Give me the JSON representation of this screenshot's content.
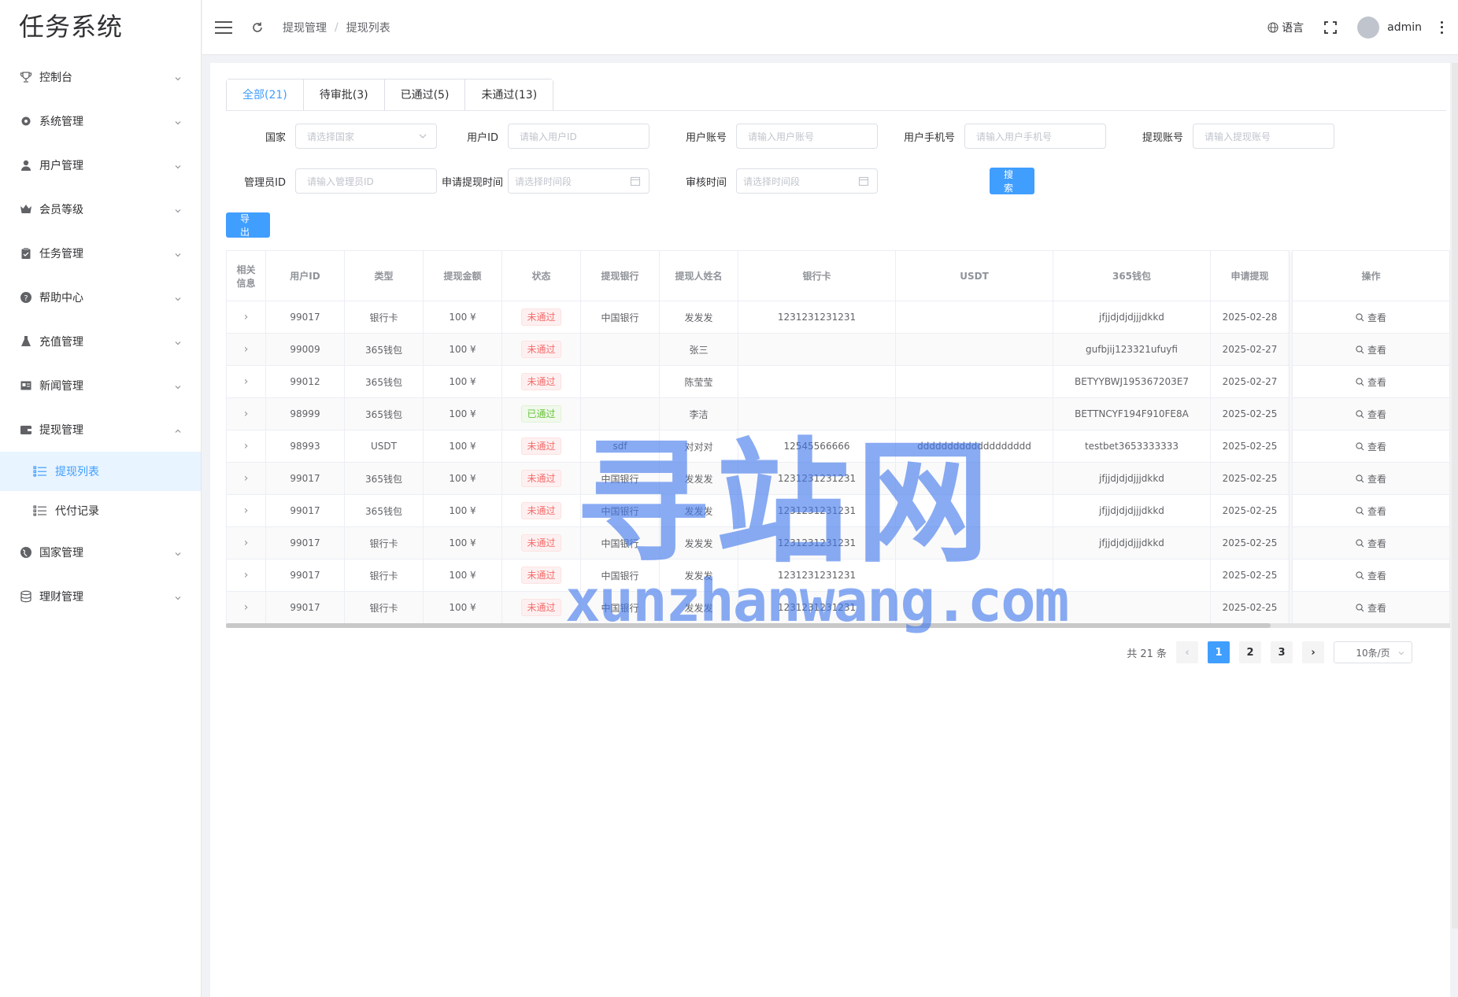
{
  "app": {
    "title": "任务系统"
  },
  "sidebar": {
    "items": [
      {
        "label": "控制台",
        "icon": "trophy-icon"
      },
      {
        "label": "系统管理",
        "icon": "gear-icon"
      },
      {
        "label": "用户管理",
        "icon": "user-icon"
      },
      {
        "label": "会员等级",
        "icon": "crown-icon"
      },
      {
        "label": "任务管理",
        "icon": "clipboard-icon"
      },
      {
        "label": "帮助中心",
        "icon": "question-icon"
      },
      {
        "label": "充值管理",
        "icon": "flask-icon"
      },
      {
        "label": "新闻管理",
        "icon": "news-icon"
      },
      {
        "label": "提现管理",
        "icon": "wallet-icon",
        "expanded": true
      }
    ],
    "submenu": [
      {
        "label": "提现列表",
        "active": true
      },
      {
        "label": "代付记录",
        "active": false
      }
    ],
    "items_after": [
      {
        "label": "国家管理",
        "icon": "globe-icon"
      },
      {
        "label": "理财管理",
        "icon": "database-icon"
      }
    ]
  },
  "header": {
    "breadcrumb": [
      "提现管理",
      "提现列表"
    ],
    "breadcrumb_sep": "/",
    "language_label": "语言",
    "username": "admin"
  },
  "tabs": [
    {
      "label": "全部(21)",
      "active": true
    },
    {
      "label": "待审批(3)",
      "active": false
    },
    {
      "label": "已通过(5)",
      "active": false
    },
    {
      "label": "未通过(13)",
      "active": false
    }
  ],
  "filters": {
    "country": {
      "label": "国家",
      "placeholder": "请选择国家"
    },
    "user_id": {
      "label": "用户ID",
      "placeholder": "请输入用户ID"
    },
    "user_account": {
      "label": "用户账号",
      "placeholder": "请输入用户账号"
    },
    "user_phone": {
      "label": "用户手机号",
      "placeholder": "请输入用户手机号"
    },
    "withdraw_account": {
      "label": "提现账号",
      "placeholder": "请输入提现账号"
    },
    "admin_id": {
      "label": "管理员ID",
      "placeholder": "请输入管理员ID"
    },
    "apply_time": {
      "label": "申请提现时间",
      "placeholder": "请选择时间段"
    },
    "review_time": {
      "label": "审核时间",
      "placeholder": "请选择时间段"
    },
    "search_label": "搜索"
  },
  "export_label": "导出",
  "table": {
    "columns": {
      "related_1": "相关",
      "related_2": "信息",
      "user_id": "用户ID",
      "type": "类型",
      "amount": "提现金额",
      "status": "状态",
      "bank": "提现银行",
      "name": "提现人姓名",
      "card": "银行卡",
      "usdt": "USDT",
      "wallet": "365钱包",
      "apply": "申请提现",
      "action": "操作"
    },
    "view_label": "查看",
    "rows": [
      {
        "user_id": "99017",
        "type": "银行卡",
        "amount": "100 ¥",
        "status": "未通过",
        "status_kind": "fail",
        "bank": "中国银行",
        "name": "发发发",
        "card": "1231231231231",
        "usdt": "",
        "wallet": "jfjjdjdjdjjjdkkd",
        "apply": "2025-02-28"
      },
      {
        "user_id": "99009",
        "type": "365钱包",
        "amount": "100 ¥",
        "status": "未通过",
        "status_kind": "fail",
        "bank": "",
        "name": "张三",
        "card": "",
        "usdt": "",
        "wallet": "gufbjij123321ufuyfi",
        "apply": "2025-02-27"
      },
      {
        "user_id": "99012",
        "type": "365钱包",
        "amount": "100 ¥",
        "status": "未通过",
        "status_kind": "fail",
        "bank": "",
        "name": "陈莹莹",
        "card": "",
        "usdt": "",
        "wallet": "BETYYBWJ195367203E7",
        "apply": "2025-02-27"
      },
      {
        "user_id": "98999",
        "type": "365钱包",
        "amount": "100 ¥",
        "status": "已通过",
        "status_kind": "pass",
        "bank": "",
        "name": "李洁",
        "card": "",
        "usdt": "",
        "wallet": "BETTNCYF194F910FE8A",
        "apply": "2025-02-25"
      },
      {
        "user_id": "98993",
        "type": "USDT",
        "amount": "100 ¥",
        "status": "未通过",
        "status_kind": "fail",
        "bank": "sdf",
        "name": "对对对",
        "card": "12545566666",
        "usdt": "ddddddddddddddddddd",
        "wallet": "testbet3653333333",
        "apply": "2025-02-25"
      },
      {
        "user_id": "99017",
        "type": "365钱包",
        "amount": "100 ¥",
        "status": "未通过",
        "status_kind": "fail",
        "bank": "中国银行",
        "name": "发发发",
        "card": "1231231231231",
        "usdt": "",
        "wallet": "jfjjdjdjdjjjdkkd",
        "apply": "2025-02-25"
      },
      {
        "user_id": "99017",
        "type": "365钱包",
        "amount": "100 ¥",
        "status": "未通过",
        "status_kind": "fail",
        "bank": "中国银行",
        "name": "发发发",
        "card": "1231231231231",
        "usdt": "",
        "wallet": "jfjjdjdjdjjjdkkd",
        "apply": "2025-02-25"
      },
      {
        "user_id": "99017",
        "type": "银行卡",
        "amount": "100 ¥",
        "status": "未通过",
        "status_kind": "fail",
        "bank": "中国银行",
        "name": "发发发",
        "card": "1231231231231",
        "usdt": "",
        "wallet": "jfjjdjdjdjjjdkkd",
        "apply": "2025-02-25"
      },
      {
        "user_id": "99017",
        "type": "银行卡",
        "amount": "100 ¥",
        "status": "未通过",
        "status_kind": "fail",
        "bank": "中国银行",
        "name": "发发发",
        "card": "1231231231231",
        "usdt": "",
        "wallet": "",
        "apply": "2025-02-25"
      },
      {
        "user_id": "99017",
        "type": "银行卡",
        "amount": "100 ¥",
        "status": "未通过",
        "status_kind": "fail",
        "bank": "中国银行",
        "name": "发发发",
        "card": "1231231231231",
        "usdt": "",
        "wallet": "",
        "apply": "2025-02-25"
      }
    ]
  },
  "pagination": {
    "total_label": "共 21 条",
    "pages": [
      "1",
      "2",
      "3"
    ],
    "current_page": "1",
    "page_size_label": "10条/页"
  },
  "watermark": {
    "big": "寻站网",
    "small": "xunzhanwang.com"
  },
  "colors": {
    "primary": "#409eff",
    "fail": "#f56c6c",
    "pass": "#67c23a",
    "active_bg": "#e8f4ff"
  }
}
